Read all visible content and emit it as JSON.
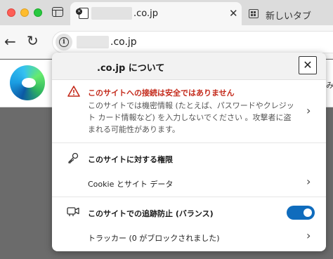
{
  "tabs": {
    "active": {
      "title": ".co.jp",
      "close": "✕"
    },
    "new": {
      "title": "新しいタブ"
    }
  },
  "toolbar": {
    "back": "←",
    "reload": "↻",
    "address": ".co.jp",
    "info": "i"
  },
  "page": {
    "side_char": "み"
  },
  "flyout": {
    "title": ".co.jp について",
    "close": "✕",
    "warning": {
      "title": "このサイトへの接続は安全ではありません",
      "body": "このサイトでは機密情報 (たとえば、パスワードやクレジット カード情報など) を入力しないでください 。攻撃者に盗まれる可能性があります。",
      "color": "#c42b1c"
    },
    "permissions": {
      "title": "このサイトに対する権限",
      "cookie": "Cookie とサイト データ"
    },
    "tracking": {
      "title": "このサイトでの追跡防止 (バランス)",
      "enabled": true,
      "trackers": "トラッカー (0 がブロックされました)",
      "toggle_color": "#0f6cbd"
    },
    "chevron": "›"
  }
}
